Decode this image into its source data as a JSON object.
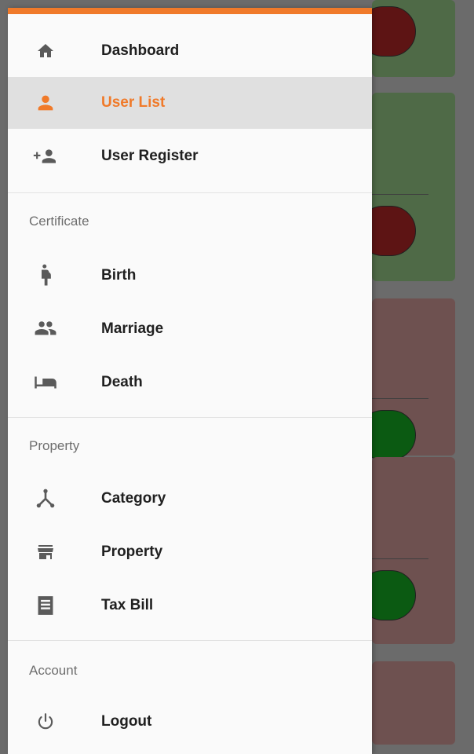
{
  "drawer": {
    "accent_color": "#f07a2a",
    "items": [
      {
        "label": "Dashboard",
        "icon": "home-icon"
      },
      {
        "label": "User List",
        "icon": "person-icon",
        "active": true
      },
      {
        "label": "User Register",
        "icon": "person-add-icon"
      }
    ],
    "sections": [
      {
        "title": "Certificate",
        "items": [
          {
            "label": "Birth",
            "icon": "pregnant-woman-icon"
          },
          {
            "label": "Marriage",
            "icon": "people-icon"
          },
          {
            "label": "Death",
            "icon": "bed-icon"
          }
        ]
      },
      {
        "title": "Property",
        "items": [
          {
            "label": "Category",
            "icon": "hub-category-icon"
          },
          {
            "label": "Property",
            "icon": "store-icon"
          },
          {
            "label": "Tax Bill",
            "icon": "receipt-icon"
          }
        ]
      },
      {
        "title": "Account",
        "items": [
          {
            "label": "Logout",
            "icon": "power-icon"
          }
        ]
      }
    ]
  }
}
